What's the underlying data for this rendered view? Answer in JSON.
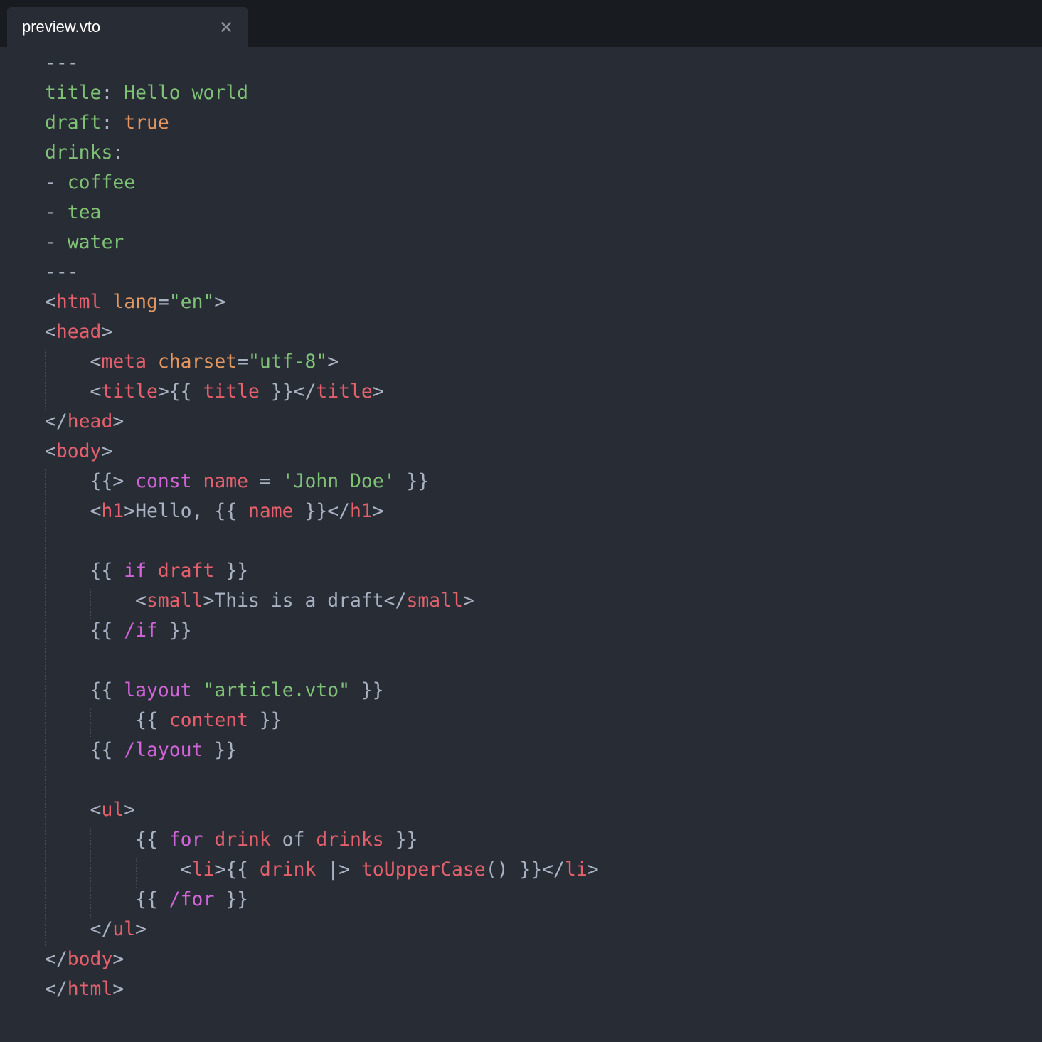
{
  "tab": {
    "title": "preview.vto",
    "close_icon": "close-icon",
    "active": true
  },
  "colors": {
    "background": "#282c35",
    "tabbar": "#181b20",
    "punctuation": "#a9b2c3",
    "string_key": "#7fc276",
    "attribute_boolean": "#e49760",
    "tag_variable": "#e4606c",
    "keyword": "#d164d8"
  },
  "code": {
    "lines": [
      [
        {
          "t": "---",
          "c": "p"
        }
      ],
      [
        {
          "t": "title",
          "c": "g"
        },
        {
          "t": ": ",
          "c": "p"
        },
        {
          "t": "Hello world",
          "c": "g"
        }
      ],
      [
        {
          "t": "draft",
          "c": "g"
        },
        {
          "t": ": ",
          "c": "p"
        },
        {
          "t": "true",
          "c": "o"
        }
      ],
      [
        {
          "t": "drinks",
          "c": "g"
        },
        {
          "t": ":",
          "c": "p"
        }
      ],
      [
        {
          "t": "- ",
          "c": "p"
        },
        {
          "t": "coffee",
          "c": "g"
        }
      ],
      [
        {
          "t": "- ",
          "c": "p"
        },
        {
          "t": "tea",
          "c": "g"
        }
      ],
      [
        {
          "t": "- ",
          "c": "p"
        },
        {
          "t": "water",
          "c": "g"
        }
      ],
      [
        {
          "t": "---",
          "c": "p"
        }
      ],
      [
        {
          "t": "<",
          "c": "p"
        },
        {
          "t": "html",
          "c": "r"
        },
        {
          "t": " ",
          "c": "p"
        },
        {
          "t": "lang",
          "c": "o"
        },
        {
          "t": "=",
          "c": "p"
        },
        {
          "t": "\"en\"",
          "c": "g"
        },
        {
          "t": ">",
          "c": "p"
        }
      ],
      [
        {
          "t": "<",
          "c": "p"
        },
        {
          "t": "head",
          "c": "r"
        },
        {
          "t": ">",
          "c": "p"
        }
      ],
      [
        {
          "t": "    <",
          "c": "p"
        },
        {
          "t": "meta",
          "c": "r"
        },
        {
          "t": " ",
          "c": "p"
        },
        {
          "t": "charset",
          "c": "o"
        },
        {
          "t": "=",
          "c": "p"
        },
        {
          "t": "\"utf-8\"",
          "c": "g"
        },
        {
          "t": ">",
          "c": "p"
        }
      ],
      [
        {
          "t": "    <",
          "c": "p"
        },
        {
          "t": "title",
          "c": "r"
        },
        {
          "t": ">{{ ",
          "c": "p"
        },
        {
          "t": "title",
          "c": "r"
        },
        {
          "t": " }}</",
          "c": "p"
        },
        {
          "t": "title",
          "c": "r"
        },
        {
          "t": ">",
          "c": "p"
        }
      ],
      [
        {
          "t": "</",
          "c": "p"
        },
        {
          "t": "head",
          "c": "r"
        },
        {
          "t": ">",
          "c": "p"
        }
      ],
      [
        {
          "t": "<",
          "c": "p"
        },
        {
          "t": "body",
          "c": "r"
        },
        {
          "t": ">",
          "c": "p"
        }
      ],
      [
        {
          "t": "    {{> ",
          "c": "p"
        },
        {
          "t": "const",
          "c": "m"
        },
        {
          "t": " ",
          "c": "p"
        },
        {
          "t": "name",
          "c": "r"
        },
        {
          "t": " = ",
          "c": "p"
        },
        {
          "t": "'John Doe'",
          "c": "g"
        },
        {
          "t": " }}",
          "c": "p"
        }
      ],
      [
        {
          "t": "    <",
          "c": "p"
        },
        {
          "t": "h1",
          "c": "r"
        },
        {
          "t": ">Hello, {{ ",
          "c": "p"
        },
        {
          "t": "name",
          "c": "r"
        },
        {
          "t": " }}</",
          "c": "p"
        },
        {
          "t": "h1",
          "c": "r"
        },
        {
          "t": ">",
          "c": "p"
        }
      ],
      [],
      [
        {
          "t": "    {{ ",
          "c": "p"
        },
        {
          "t": "if",
          "c": "m"
        },
        {
          "t": " ",
          "c": "p"
        },
        {
          "t": "draft",
          "c": "r"
        },
        {
          "t": " }}",
          "c": "p"
        }
      ],
      [
        {
          "t": "        <",
          "c": "p"
        },
        {
          "t": "small",
          "c": "r"
        },
        {
          "t": ">This is a draft</",
          "c": "p"
        },
        {
          "t": "small",
          "c": "r"
        },
        {
          "t": ">",
          "c": "p"
        }
      ],
      [
        {
          "t": "    {{ ",
          "c": "p"
        },
        {
          "t": "/if",
          "c": "m"
        },
        {
          "t": " }}",
          "c": "p"
        }
      ],
      [],
      [
        {
          "t": "    {{ ",
          "c": "p"
        },
        {
          "t": "layout",
          "c": "m"
        },
        {
          "t": " ",
          "c": "p"
        },
        {
          "t": "\"article.vto\"",
          "c": "g"
        },
        {
          "t": " }}",
          "c": "p"
        }
      ],
      [
        {
          "t": "        {{ ",
          "c": "p"
        },
        {
          "t": "content",
          "c": "r"
        },
        {
          "t": " }}",
          "c": "p"
        }
      ],
      [
        {
          "t": "    {{ ",
          "c": "p"
        },
        {
          "t": "/layout",
          "c": "m"
        },
        {
          "t": " }}",
          "c": "p"
        }
      ],
      [],
      [
        {
          "t": "    <",
          "c": "p"
        },
        {
          "t": "ul",
          "c": "r"
        },
        {
          "t": ">",
          "c": "p"
        }
      ],
      [
        {
          "t": "        {{ ",
          "c": "p"
        },
        {
          "t": "for",
          "c": "m"
        },
        {
          "t": " ",
          "c": "p"
        },
        {
          "t": "drink",
          "c": "r"
        },
        {
          "t": " of ",
          "c": "p"
        },
        {
          "t": "drinks",
          "c": "r"
        },
        {
          "t": " }}",
          "c": "p"
        }
      ],
      [
        {
          "t": "            <",
          "c": "p"
        },
        {
          "t": "li",
          "c": "r"
        },
        {
          "t": ">{{ ",
          "c": "p"
        },
        {
          "t": "drink",
          "c": "r"
        },
        {
          "t": " |> ",
          "c": "p"
        },
        {
          "t": "toUpperCase",
          "c": "r"
        },
        {
          "t": "() }}</",
          "c": "p"
        },
        {
          "t": "li",
          "c": "r"
        },
        {
          "t": ">",
          "c": "p"
        }
      ],
      [
        {
          "t": "        {{ ",
          "c": "p"
        },
        {
          "t": "/for",
          "c": "m"
        },
        {
          "t": " }}",
          "c": "p"
        }
      ],
      [
        {
          "t": "    </",
          "c": "p"
        },
        {
          "t": "ul",
          "c": "r"
        },
        {
          "t": ">",
          "c": "p"
        }
      ],
      [
        {
          "t": "</",
          "c": "p"
        },
        {
          "t": "body",
          "c": "r"
        },
        {
          "t": ">",
          "c": "p"
        }
      ],
      [
        {
          "t": "</",
          "c": "p"
        },
        {
          "t": "html",
          "c": "r"
        },
        {
          "t": ">",
          "c": "p"
        }
      ]
    ]
  }
}
